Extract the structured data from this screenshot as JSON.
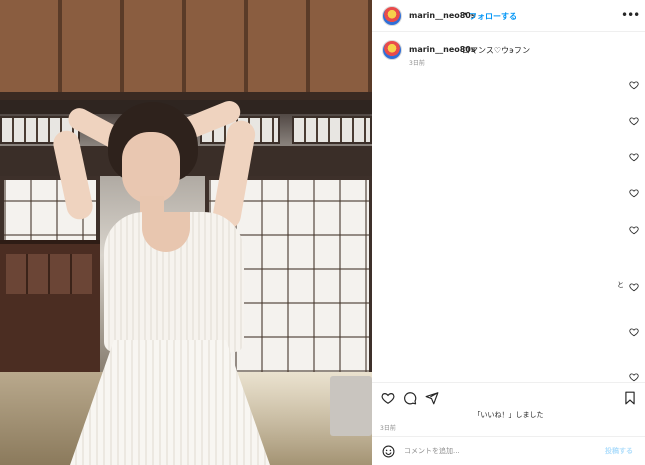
{
  "post": {
    "username": "marin__neo80s",
    "follow_label": "フォローする",
    "separator": "•",
    "more_label": "•••",
    "photo_alt": "photo"
  },
  "caption": {
    "username": "marin__neo80s",
    "text": "ロマンス♡ウ϶フン",
    "time": "3日前"
  },
  "side_glyph": "と",
  "likes_text": "「いいね！」しました",
  "post_time": "3日前",
  "comment": {
    "placeholder": "コメントを追加...",
    "value": "",
    "post_label": "投稿する"
  },
  "colors": {
    "follow_blue": "#0095f6",
    "post_disabled": "#b2dffc",
    "muted_text": "#8e8e8e",
    "divider": "#efefef"
  },
  "icons": [
    "heart-icon",
    "comment-icon",
    "share-icon",
    "bookmark-icon",
    "emoji-icon",
    "more-icon"
  ]
}
